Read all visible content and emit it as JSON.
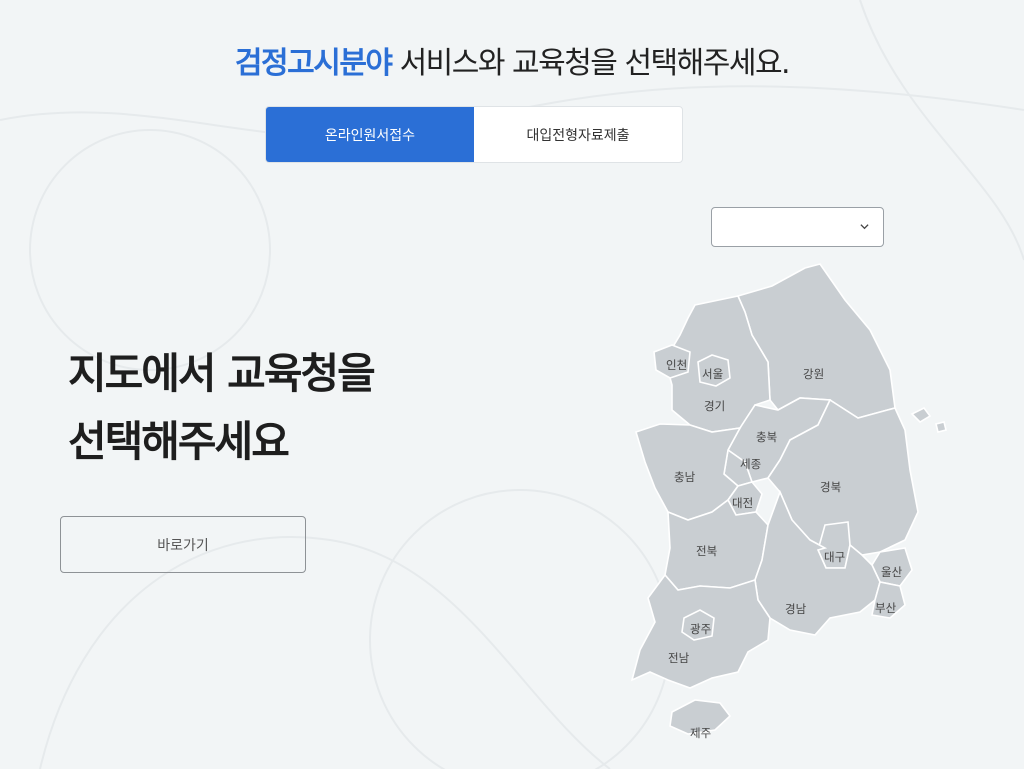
{
  "headline": {
    "accent": "검정고시분야",
    "rest": " 서비스와 교육청을 선택해주세요."
  },
  "tabs": [
    {
      "label": "온라인원서접수",
      "active": true
    },
    {
      "label": "대입전형자료제출",
      "active": false
    }
  ],
  "region_select": {
    "value": "",
    "icon": "chevron-down-icon"
  },
  "main_title": {
    "line1": "지도에서 교육청을",
    "line2": "선택해주세요"
  },
  "go_button": {
    "label": "바로가기"
  },
  "map": {
    "regions": {
      "incheon": "인천",
      "seoul": "서울",
      "gangwon": "강원",
      "gyeonggi": "경기",
      "chungbuk": "충북",
      "sejong": "세종",
      "chungnam": "충남",
      "gyeongbuk": "경북",
      "daejeon": "대전",
      "jeonbuk": "전북",
      "daegu": "대구",
      "ulsan": "울산",
      "gwangju": "광주",
      "gyeongnam": "경남",
      "busan": "부산",
      "jeonnam": "전남",
      "jeju": "제주"
    }
  },
  "colors": {
    "accent": "#2b6fd6",
    "background": "#f2f5f6",
    "map_fill": "#c9ced2"
  }
}
